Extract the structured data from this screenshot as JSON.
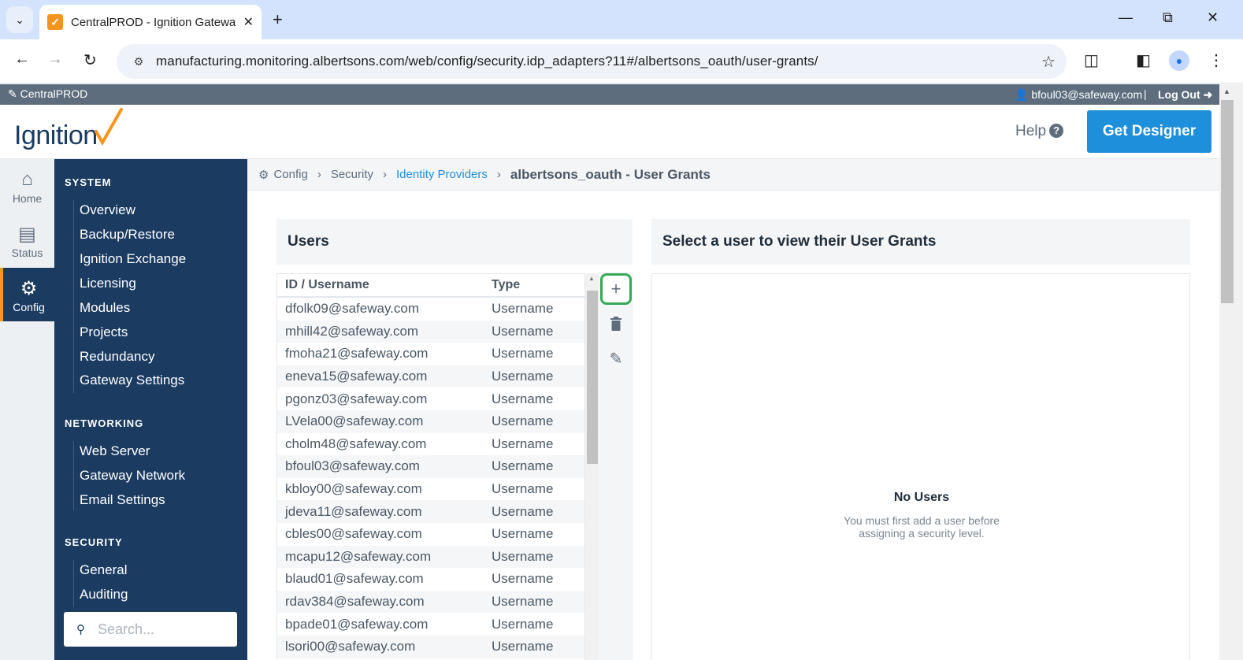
{
  "browser": {
    "tab_title": "CentralPROD - Ignition Gateway",
    "url": "manufacturing.monitoring.albertsons.com/web/config/security.idp_adapters?11#/albertsons_oauth/user-grants/"
  },
  "gateway": {
    "name": "CentralPROD",
    "user": "bfoul03@safeway.com",
    "separator": "|",
    "logout": "Log Out",
    "logo_text": "Ignition",
    "help": "Help",
    "designer_button": "Get Designer"
  },
  "rail": {
    "home": "Home",
    "status": "Status",
    "config": "Config"
  },
  "sidebar": {
    "system": {
      "heading": "SYSTEM",
      "items": [
        "Overview",
        "Backup/Restore",
        "Ignition Exchange",
        "Licensing",
        "Modules",
        "Projects",
        "Redundancy",
        "Gateway Settings"
      ]
    },
    "networking": {
      "heading": "NETWORKING",
      "items": [
        "Web Server",
        "Gateway Network",
        "Email Settings"
      ]
    },
    "security": {
      "heading": "SECURITY",
      "items": [
        "General",
        "Auditing"
      ]
    },
    "search_placeholder": "Search..."
  },
  "breadcrumb": {
    "config": "Config",
    "security": "Security",
    "identity_providers": "Identity Providers",
    "current": "albertsons_oauth - User Grants"
  },
  "users_panel": {
    "title": "Users",
    "columns": [
      "ID / Username",
      "Type"
    ],
    "rows": [
      [
        "dfolk09@safeway.com",
        "Username"
      ],
      [
        "mhill42@safeway.com",
        "Username"
      ],
      [
        "fmoha21@safeway.com",
        "Username"
      ],
      [
        "eneva15@safeway.com",
        "Username"
      ],
      [
        "pgonz03@safeway.com",
        "Username"
      ],
      [
        "LVela00@safeway.com",
        "Username"
      ],
      [
        "cholm48@safeway.com",
        "Username"
      ],
      [
        "bfoul03@safeway.com",
        "Username"
      ],
      [
        "kbloy00@safeway.com",
        "Username"
      ],
      [
        "jdeva11@safeway.com",
        "Username"
      ],
      [
        "cbles00@safeway.com",
        "Username"
      ],
      [
        "mcapu12@safeway.com",
        "Username"
      ],
      [
        "blaud01@safeway.com",
        "Username"
      ],
      [
        "rdav384@safeway.com",
        "Username"
      ],
      [
        "bpade01@safeway.com",
        "Username"
      ],
      [
        "lsori00@safeway.com",
        "Username"
      ]
    ]
  },
  "grants_panel": {
    "title": "Select a user to view their User Grants",
    "empty_title": "No Users",
    "empty_message": "You must first add a user before assigning a security level."
  },
  "colors": {
    "sidebar_bg": "#1b3b61",
    "accent": "#f7941d",
    "link": "#1e8fdb",
    "add_highlight": "#34a853"
  }
}
